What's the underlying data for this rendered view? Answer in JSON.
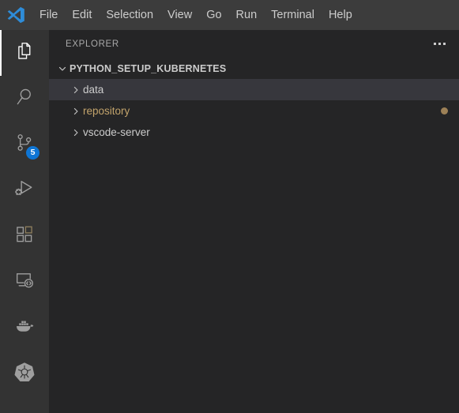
{
  "titlebar": {
    "logo_icon": "vscode-logo-icon",
    "menu": [
      {
        "label": "File"
      },
      {
        "label": "Edit"
      },
      {
        "label": "Selection"
      },
      {
        "label": "View"
      },
      {
        "label": "Go"
      },
      {
        "label": "Run"
      },
      {
        "label": "Terminal"
      },
      {
        "label": "Help"
      }
    ]
  },
  "activitybar": {
    "items": [
      {
        "name": "explorer",
        "icon": "files-icon",
        "active": true,
        "badge": null
      },
      {
        "name": "search",
        "icon": "search-icon",
        "active": false,
        "badge": null
      },
      {
        "name": "source-control",
        "icon": "source-control-icon",
        "active": false,
        "badge": "5"
      },
      {
        "name": "run-and-debug",
        "icon": "run-and-debug-icon",
        "active": false,
        "badge": null
      },
      {
        "name": "extensions",
        "icon": "extensions-icon",
        "active": false,
        "badge": null
      },
      {
        "name": "remote-explorer",
        "icon": "remote-explorer-icon",
        "active": false,
        "badge": null
      },
      {
        "name": "docker",
        "icon": "docker-whale-icon",
        "active": false,
        "badge": null
      },
      {
        "name": "kubernetes",
        "icon": "kubernetes-helm-icon",
        "active": false,
        "badge": null
      }
    ]
  },
  "sidebar": {
    "title": "EXPLORER",
    "more_actions_icon": "ellipsis-icon",
    "tree": {
      "root": {
        "label": "PYTHON_SETUP_KUBERNETES",
        "expanded": true,
        "chevron_icon": "chevron-down-icon"
      },
      "items": [
        {
          "label": "data",
          "expanded": false,
          "chevron_icon": "chevron-right-icon",
          "selected": true,
          "modified": false,
          "status_dot": false
        },
        {
          "label": "repository",
          "expanded": false,
          "chevron_icon": "chevron-right-icon",
          "selected": false,
          "modified": true,
          "status_dot": true
        },
        {
          "label": "vscode-server",
          "expanded": false,
          "chevron_icon": "chevron-right-icon",
          "selected": false,
          "modified": false,
          "status_dot": false
        }
      ]
    }
  },
  "colors": {
    "titlebar_bg": "#3c3c3c",
    "activitybar_bg": "#333333",
    "sidebar_bg": "#252526",
    "selected_row_bg": "#37373d",
    "badge_bg": "#0e75d4",
    "modified_text": "#c2a36b",
    "status_dot": "#9d8157",
    "accent_logo": "#2e8cd8"
  }
}
